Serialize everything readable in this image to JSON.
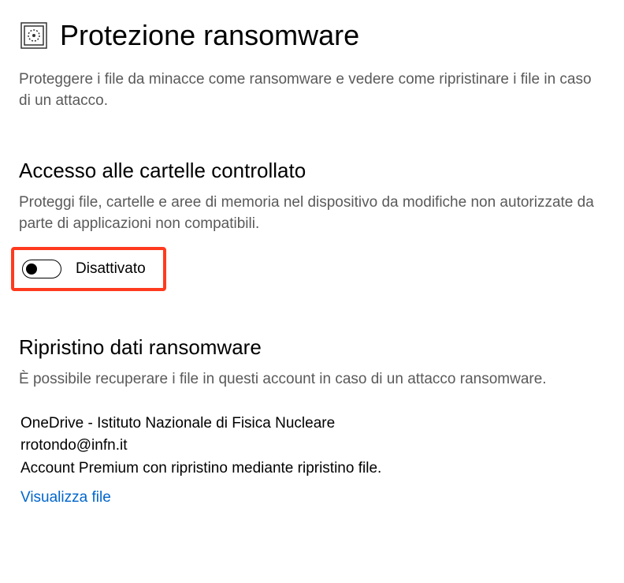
{
  "header": {
    "title": "Protezione ransomware",
    "description": "Proteggere i file da minacce come ransomware e vedere come ripristinare i file in caso di un attacco."
  },
  "controlled_access": {
    "title": "Accesso alle cartelle controllato",
    "description": "Proteggi file, cartelle e aree di memoria nel dispositivo da modifiche non autorizzate da parte di applicazioni non compatibili.",
    "toggle_state": "Disattivato",
    "toggle_on": false
  },
  "recovery": {
    "title": "Ripristino dati ransomware",
    "description": "È possibile recuperare i file in questi account in caso di un attacco ransomware.",
    "account_name": "OneDrive - Istituto Nazionale di Fisica Nucleare",
    "account_email": "rrotondo@infn.it",
    "account_info": "Account Premium con ripristino mediante ripristino file.",
    "view_link": "Visualizza file"
  },
  "colors": {
    "highlight": "#ff3a1e",
    "link": "#0066cc",
    "text_secondary": "#5a5a5a"
  }
}
